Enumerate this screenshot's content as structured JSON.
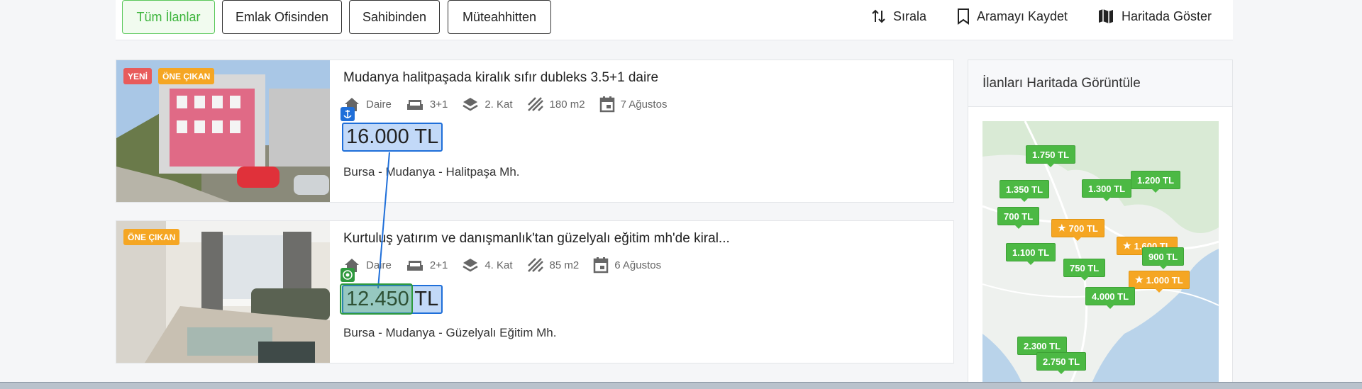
{
  "filters": {
    "all": "Tüm İlanlar",
    "office": "Emlak Ofisinden",
    "owner": "Sahibinden",
    "contractor": "Müteahhitten"
  },
  "actions": {
    "sort": "Sırala",
    "save_search": "Aramayı Kaydet",
    "show_map": "Haritada Göster"
  },
  "listings": [
    {
      "badges": [
        "YENİ",
        "ÖNE ÇIKAN"
      ],
      "title": "Mudanya halitpaşada kiralık sıfır dubleks 3.5+1 daire",
      "type": "Daire",
      "rooms": "3+1",
      "floor": "2. Kat",
      "area": "180 m2",
      "date": "7 Ağustos",
      "price": "16.000 TL",
      "location": "Bursa - Mudanya - Halitpaşa Mh."
    },
    {
      "badges": [
        "ÖNE ÇIKAN"
      ],
      "title": "Kurtuluş yatırım ve danışmanlık'tan güzelyalı eğitim mh'de kiral...",
      "type": "Daire",
      "rooms": "2+1",
      "floor": "4. Kat",
      "area": "85 m2",
      "date": "6 Ağustos",
      "price": "12.450 TL",
      "location": "Bursa - Mudanya - Güzelyalı Eğitim Mh."
    }
  ],
  "map": {
    "title": "İlanları Haritada Görüntüle",
    "pins": [
      {
        "label": "1.750 TL",
        "color": "green"
      },
      {
        "label": "1.350 TL",
        "color": "green"
      },
      {
        "label": "1.300 TL",
        "color": "green"
      },
      {
        "label": "1.200 TL",
        "color": "green"
      },
      {
        "label": "700 TL",
        "color": "green"
      },
      {
        "label": "700 TL",
        "color": "orange"
      },
      {
        "label": "1.600 TL",
        "color": "orange"
      },
      {
        "label": "1.100 TL",
        "color": "green"
      },
      {
        "label": "900 TL",
        "color": "green"
      },
      {
        "label": "750 TL",
        "color": "green"
      },
      {
        "label": "1.000 TL",
        "color": "orange"
      },
      {
        "label": "4.000 TL",
        "color": "green"
      },
      {
        "label": "2.300 TL",
        "color": "green"
      },
      {
        "label": "2.750 TL",
        "color": "green"
      }
    ]
  },
  "colors": {
    "accent_green": "#3db53d",
    "badge_new": "#e85b5b",
    "badge_featured": "#f5a623",
    "selection_blue": "#1f6fd9"
  }
}
